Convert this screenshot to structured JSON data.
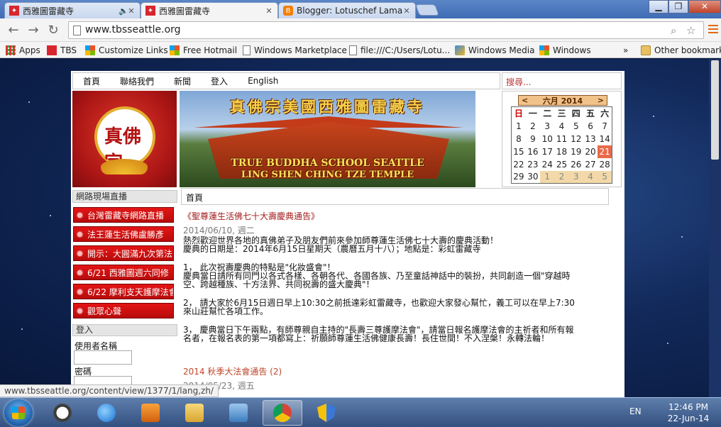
{
  "browser": {
    "tabs": [
      {
        "label": "西雅圖雷藏寺",
        "favicon": "tbs-favicon",
        "audio": true,
        "active": false
      },
      {
        "label": "西雅圖雷藏寺",
        "favicon": "tbs-favicon",
        "audio": false,
        "active": true
      },
      {
        "label": "Blogger: Lotuschef Lama P",
        "favicon": "blogger-icon",
        "audio": false,
        "active": false
      }
    ],
    "url": "www.tbsseattle.org",
    "window_controls": [
      "minimize",
      "maximize",
      "close"
    ],
    "bookmarks": [
      {
        "label": "Apps",
        "icon": "apps-grid-icon"
      },
      {
        "label": "TBS",
        "icon": "tbs-favicon"
      },
      {
        "label": "Customize Links",
        "icon": "windows-flag-icon"
      },
      {
        "label": "Free Hotmail",
        "icon": "windows-flag-icon"
      },
      {
        "label": "Windows Marketplace",
        "icon": "page-icon"
      },
      {
        "label": "file:///C:/Users/Lotu...",
        "icon": "page-icon"
      },
      {
        "label": "Windows Media",
        "icon": "media-icon"
      },
      {
        "label": "Windows",
        "icon": "windows-flag-icon"
      },
      {
        "label": "»",
        "icon": ""
      },
      {
        "label": "Other bookmarks",
        "icon": "folder-icon"
      }
    ]
  },
  "site": {
    "nav": [
      "首頁",
      "聯絡我們",
      "新聞",
      "登入",
      "English"
    ],
    "search_placeholder": "搜尋...",
    "logo_text": "真佛宗",
    "banner": {
      "title": "真佛宗美國西雅圖雷藏寺",
      "en_line1": "TRUE BUDDHA SCHOOL SEATTLE",
      "en_line2": "LING SHEN CHING TZE TEMPLE"
    },
    "calendar": {
      "prev": "<",
      "month": "六月 2014",
      "next": ">",
      "weekdays": [
        "日",
        "一",
        "二",
        "三",
        "四",
        "五",
        "六"
      ],
      "weeks": [
        [
          "1",
          "2",
          "3",
          "4",
          "5",
          "6",
          "7"
        ],
        [
          "8",
          "9",
          "10",
          "11",
          "12",
          "13",
          "14"
        ],
        [
          "15",
          "16",
          "17",
          "18",
          "19",
          "20",
          "21"
        ],
        [
          "22",
          "23",
          "24",
          "25",
          "26",
          "27",
          "28"
        ],
        [
          "29",
          "30",
          "1",
          "2",
          "3",
          "4",
          "5"
        ]
      ],
      "today": "21"
    },
    "sidebar": {
      "live_title": "網路現場直播",
      "live_items": [
        "台灣雷藏寺網路直播",
        "法王蓮生活佛盧勝彥",
        "開示：大圓滿九次第法",
        "6/21 西雅圖週六同修",
        "6/22 摩利支天護摩法會",
        "觀眾心聲"
      ],
      "login_title": "登入",
      "username_label": "使用者名稱",
      "password_label": "密碼"
    },
    "breadcrumb": "首頁",
    "articles": [
      {
        "title": "《聖尊蓮生活佛七十大壽慶典通告》",
        "date": "2014/06/10, 週二",
        "paragraphs": [
          [
            "熱烈歡迎世界各地的真佛弟子及朋友們前來參加師尊蓮生活佛七十大壽的慶典活動！",
            "慶典的日期是：2014年6月15日星期天（農曆五月十八）；地點是：彩虹雷藏寺"
          ],
          [
            "1， 此次祝壽慶典的特點是\"化妝盛會\"！",
            "慶典當日請所有同門以各式各樣、各朝各代、各國各族、乃至童話神話中的裝扮，共同創造一個\"穿越時",
            "空、跨越種族、十方法界、共同祝壽的盛大慶典\"！"
          ],
          [
            "2， 請大家於6月15日週日早上10:30之前抵達彩虹雷藏寺，也歡迎大家發心幫忙，義工可以在早上7:30",
            "來山莊幫忙各項工作。"
          ],
          [
            "3， 慶典當日下午兩點，有師尊親自主持的\"長壽三尊護摩法會\"，請當日報名護摩法會的主祈者和所有報",
            "名者，在報名表的第一項都寫上：祈願師尊蓮生活佛健康長壽！長住世間！不入涅槃！永轉法輪！"
          ]
        ]
      },
      {
        "title": "2014 秋季大法會通告 (2)",
        "date": "2014/05/23, 週五"
      }
    ]
  },
  "status_url": "www.tbsseattle.org/content/view/1377/1/lang,zh/",
  "taskbar": {
    "apps": [
      "clock-app-icon",
      "ie-icon",
      "media-player-icon",
      "explorer-icon",
      "control-panel-icon",
      "chrome-icon",
      "security-icon"
    ],
    "lang": "EN",
    "time": "12:46 PM",
    "date": "22-Jun-14"
  },
  "colors": {
    "title_red": "#a31d1d",
    "live_red": "#d10f0f",
    "today": "#e76a4a",
    "chrome_accent": "#e36a10"
  }
}
